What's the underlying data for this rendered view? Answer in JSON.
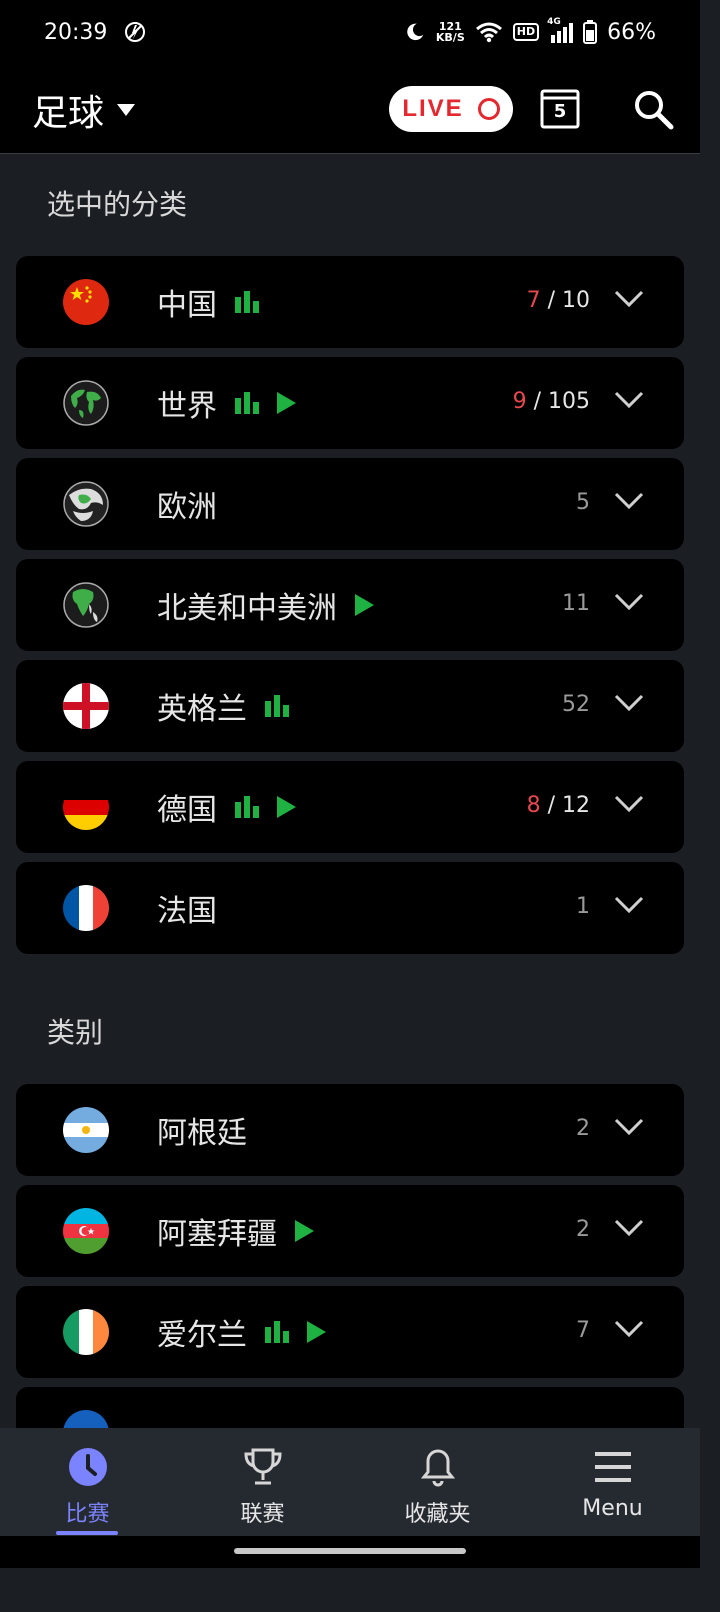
{
  "status_bar": {
    "time": "20:39",
    "net_speed_value": "121",
    "net_speed_unit": "KB/S",
    "hd": "HD",
    "network": "4G",
    "battery": "66%"
  },
  "app_bar": {
    "sport": "足球",
    "live_label": "LIVE",
    "calendar_day": "5"
  },
  "sections": [
    {
      "title": "选中的分类",
      "items": [
        {
          "name": "中国",
          "flag": "china",
          "stats": true,
          "live_video": false,
          "live": "7",
          "total": "10"
        },
        {
          "name": "世界",
          "flag": "world-globe",
          "stats": true,
          "live_video": true,
          "live": "9",
          "total": "105"
        },
        {
          "name": "欧洲",
          "flag": "europe-globe",
          "stats": false,
          "live_video": false,
          "live": null,
          "total": "5"
        },
        {
          "name": "北美和中美洲",
          "flag": "north-america-globe",
          "stats": false,
          "live_video": true,
          "live": null,
          "total": "11"
        },
        {
          "name": "英格兰",
          "flag": "england",
          "stats": true,
          "live_video": false,
          "live": null,
          "total": "52"
        },
        {
          "name": "德国",
          "flag": "germany",
          "stats": true,
          "live_video": true,
          "live": "8",
          "total": "12"
        },
        {
          "name": "法国",
          "flag": "france",
          "stats": false,
          "live_video": false,
          "live": null,
          "total": "1"
        }
      ]
    },
    {
      "title": "类别",
      "items": [
        {
          "name": "阿根廷",
          "flag": "argentina",
          "stats": false,
          "live_video": false,
          "live": null,
          "total": "2"
        },
        {
          "name": "阿塞拜疆",
          "flag": "azerbaijan",
          "stats": false,
          "live_video": true,
          "live": null,
          "total": "2"
        },
        {
          "name": "爱尔兰",
          "flag": "ireland",
          "stats": true,
          "live_video": true,
          "live": null,
          "total": "7"
        }
      ]
    }
  ],
  "bottom_nav": [
    {
      "label": "比赛",
      "icon": "clock-icon",
      "active": true
    },
    {
      "label": "联赛",
      "icon": "trophy-icon",
      "active": false
    },
    {
      "label": "收藏夹",
      "icon": "bell-icon",
      "active": false
    },
    {
      "label": "Menu",
      "icon": "menu-icon",
      "active": false
    }
  ],
  "colors": {
    "accent": "#7b83ff",
    "live_red": "#e3282f",
    "icon_green": "#1fb141",
    "card_bg": "#000000",
    "page_bg": "#1b1e23"
  }
}
